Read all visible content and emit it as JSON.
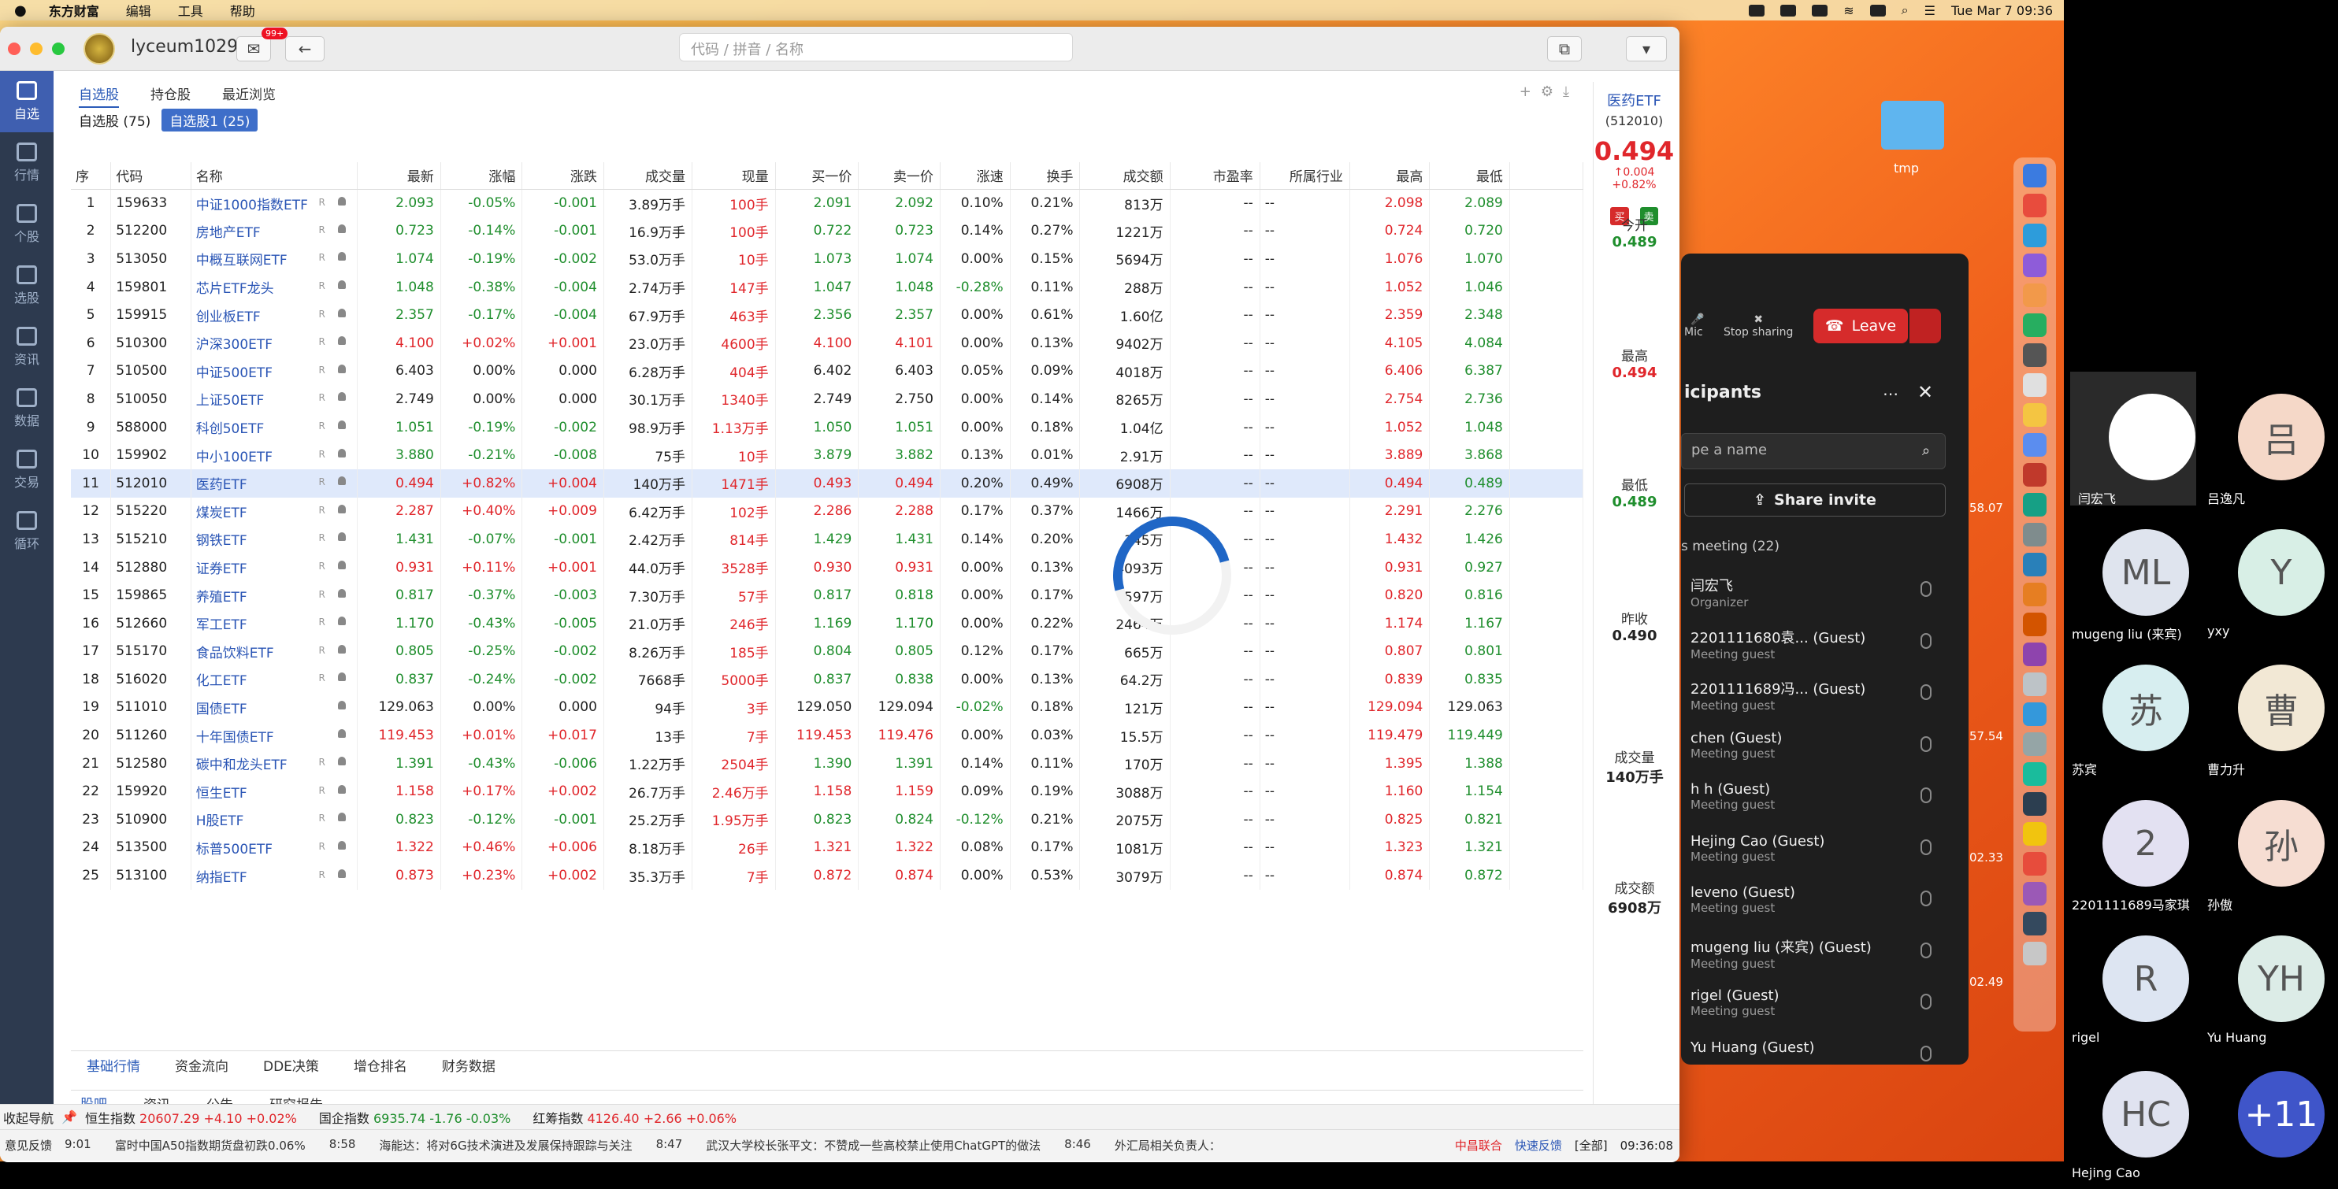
{
  "menubar": {
    "app": "东方财富",
    "menus": [
      "编辑",
      "工具",
      "帮助"
    ],
    "clock": "Tue Mar 7  09:36"
  },
  "toolbar": {
    "username": "lyceum1029",
    "badge": "99+",
    "search_placeholder": "代码 / 拼音 / 名称"
  },
  "sidebar": [
    {
      "label": "自选",
      "active": true
    },
    {
      "label": "行情"
    },
    {
      "label": "个股"
    },
    {
      "label": "选股"
    },
    {
      "label": "资讯"
    },
    {
      "label": "数据"
    },
    {
      "label": "交易"
    },
    {
      "label": "循环"
    }
  ],
  "tabs": [
    "自选股",
    "持仓股",
    "最近浏览"
  ],
  "subtabs": [
    "自选股 (75)",
    "自选股1 (25)"
  ],
  "columns": [
    "序",
    "代码",
    "名称",
    "最新",
    "涨幅",
    "涨跌",
    "成交量",
    "现量",
    "买一价",
    "卖一价",
    "涨速",
    "换手",
    "成交额",
    "市盈率",
    "所属行业",
    "最高",
    "最低"
  ],
  "rows": [
    [
      "1",
      "159633",
      "中证1000指数ETF",
      "R",
      "2.093",
      "-0.05%",
      "-0.001",
      "3.89万手",
      "100手",
      "2.091",
      "2.092",
      "0.10%",
      "0.21%",
      "813万",
      "--",
      "--",
      "2.098",
      "2.089"
    ],
    [
      "2",
      "512200",
      "房地产ETF",
      "R",
      "0.723",
      "-0.14%",
      "-0.001",
      "16.9万手",
      "100手",
      "0.722",
      "0.723",
      "0.14%",
      "0.27%",
      "1221万",
      "--",
      "--",
      "0.724",
      "0.720"
    ],
    [
      "3",
      "513050",
      "中概互联网ETF",
      "R",
      "1.074",
      "-0.19%",
      "-0.002",
      "53.0万手",
      "10手",
      "1.073",
      "1.074",
      "0.00%",
      "0.15%",
      "5694万",
      "--",
      "--",
      "1.076",
      "1.070"
    ],
    [
      "4",
      "159801",
      "芯片ETF龙头",
      "R",
      "1.048",
      "-0.38%",
      "-0.004",
      "2.74万手",
      "147手",
      "1.047",
      "1.048",
      "-0.28%",
      "0.11%",
      "288万",
      "--",
      "--",
      "1.052",
      "1.046"
    ],
    [
      "5",
      "159915",
      "创业板ETF",
      "R",
      "2.357",
      "-0.17%",
      "-0.004",
      "67.9万手",
      "463手",
      "2.356",
      "2.357",
      "0.00%",
      "0.61%",
      "1.60亿",
      "--",
      "--",
      "2.359",
      "2.348"
    ],
    [
      "6",
      "510300",
      "沪深300ETF",
      "R",
      "4.100",
      "+0.02%",
      "+0.001",
      "23.0万手",
      "4600手",
      "4.100",
      "4.101",
      "0.00%",
      "0.13%",
      "9402万",
      "--",
      "--",
      "4.105",
      "4.084"
    ],
    [
      "7",
      "510500",
      "中证500ETF",
      "R",
      "6.403",
      "0.00%",
      "0.000",
      "6.28万手",
      "404手",
      "6.402",
      "6.403",
      "0.05%",
      "0.09%",
      "4018万",
      "--",
      "--",
      "6.406",
      "6.387"
    ],
    [
      "8",
      "510050",
      "上证50ETF",
      "R",
      "2.749",
      "0.00%",
      "0.000",
      "30.1万手",
      "1340手",
      "2.749",
      "2.750",
      "0.00%",
      "0.14%",
      "8265万",
      "--",
      "--",
      "2.754",
      "2.736"
    ],
    [
      "9",
      "588000",
      "科创50ETF",
      "R",
      "1.051",
      "-0.19%",
      "-0.002",
      "98.9万手",
      "1.13万手",
      "1.050",
      "1.051",
      "0.00%",
      "0.18%",
      "1.04亿",
      "--",
      "--",
      "1.052",
      "1.048"
    ],
    [
      "10",
      "159902",
      "中小100ETF",
      "R",
      "3.880",
      "-0.21%",
      "-0.008",
      "75手",
      "10手",
      "3.879",
      "3.882",
      "0.13%",
      "0.01%",
      "2.91万",
      "--",
      "--",
      "3.889",
      "3.868"
    ],
    [
      "11",
      "512010",
      "医药ETF",
      "R",
      "0.494",
      "+0.82%",
      "+0.004",
      "140万手",
      "1471手",
      "0.493",
      "0.494",
      "0.20%",
      "0.49%",
      "6908万",
      "--",
      "--",
      "0.494",
      "0.489"
    ],
    [
      "12",
      "515220",
      "煤炭ETF",
      "R",
      "2.287",
      "+0.40%",
      "+0.009",
      "6.42万手",
      "102手",
      "2.286",
      "2.288",
      "0.17%",
      "0.37%",
      "1466万",
      "--",
      "--",
      "2.291",
      "2.276"
    ],
    [
      "13",
      "515210",
      "钢铁ETF",
      "R",
      "1.431",
      "-0.07%",
      "-0.001",
      "2.42万手",
      "814手",
      "1.429",
      "1.431",
      "0.14%",
      "0.20%",
      "345万",
      "--",
      "--",
      "1.432",
      "1.426"
    ],
    [
      "14",
      "512880",
      "证券ETF",
      "R",
      "0.931",
      "+0.11%",
      "+0.001",
      "44.0万手",
      "3528手",
      "0.930",
      "0.931",
      "0.00%",
      "0.13%",
      "4093万",
      "--",
      "--",
      "0.931",
      "0.927"
    ],
    [
      "15",
      "159865",
      "养殖ETF",
      "R",
      "0.817",
      "-0.37%",
      "-0.003",
      "7.30万手",
      "57手",
      "0.817",
      "0.818",
      "0.00%",
      "0.17%",
      "597万",
      "--",
      "--",
      "0.820",
      "0.816"
    ],
    [
      "16",
      "512660",
      "军工ETF",
      "R",
      "1.170",
      "-0.43%",
      "-0.005",
      "21.0万手",
      "246手",
      "1.169",
      "1.170",
      "0.00%",
      "0.22%",
      "2464万",
      "--",
      "--",
      "1.174",
      "1.167"
    ],
    [
      "17",
      "515170",
      "食品饮料ETF",
      "R",
      "0.805",
      "-0.25%",
      "-0.002",
      "8.26万手",
      "185手",
      "0.804",
      "0.805",
      "0.12%",
      "0.17%",
      "665万",
      "--",
      "--",
      "0.807",
      "0.801"
    ],
    [
      "18",
      "516020",
      "化工ETF",
      "R",
      "0.837",
      "-0.24%",
      "-0.002",
      "7668手",
      "5000手",
      "0.837",
      "0.838",
      "0.00%",
      "0.13%",
      "64.2万",
      "--",
      "--",
      "0.839",
      "0.835"
    ],
    [
      "19",
      "511010",
      "国债ETF",
      "",
      "129.063",
      "0.00%",
      "0.000",
      "94手",
      "3手",
      "129.050",
      "129.094",
      "-0.02%",
      "0.18%",
      "121万",
      "--",
      "--",
      "129.094",
      "129.063"
    ],
    [
      "20",
      "511260",
      "十年国债ETF",
      "",
      "119.453",
      "+0.01%",
      "+0.017",
      "13手",
      "7手",
      "119.453",
      "119.476",
      "0.00%",
      "0.03%",
      "15.5万",
      "--",
      "--",
      "119.479",
      "119.449"
    ],
    [
      "21",
      "512580",
      "碳中和龙头ETF",
      "R",
      "1.391",
      "-0.43%",
      "-0.006",
      "1.22万手",
      "2504手",
      "1.390",
      "1.391",
      "0.14%",
      "0.11%",
      "170万",
      "--",
      "--",
      "1.395",
      "1.388"
    ],
    [
      "22",
      "159920",
      "恒生ETF",
      "R",
      "1.158",
      "+0.17%",
      "+0.002",
      "26.7万手",
      "2.46万手",
      "1.158",
      "1.159",
      "0.09%",
      "0.19%",
      "3088万",
      "--",
      "--",
      "1.160",
      "1.154"
    ],
    [
      "23",
      "510900",
      "H股ETF",
      "R",
      "0.823",
      "-0.12%",
      "-0.001",
      "25.2万手",
      "1.95万手",
      "0.823",
      "0.824",
      "-0.12%",
      "0.21%",
      "2075万",
      "--",
      "--",
      "0.825",
      "0.821"
    ],
    [
      "24",
      "513500",
      "标普500ETF",
      "R",
      "1.322",
      "+0.46%",
      "+0.006",
      "8.18万手",
      "26手",
      "1.321",
      "1.322",
      "0.08%",
      "0.17%",
      "1081万",
      "--",
      "--",
      "1.323",
      "1.321"
    ],
    [
      "25",
      "513100",
      "纳指ETF",
      "R",
      "0.873",
      "+0.23%",
      "+0.002",
      "35.3万手",
      "7手",
      "0.872",
      "0.874",
      "0.00%",
      "0.53%",
      "3079万",
      "--",
      "--",
      "0.874",
      "0.872"
    ]
  ],
  "bottom_tabs": [
    "基础行情",
    "资金流向",
    "DDE决策",
    "增仓排名",
    "财务数据"
  ],
  "bottom_tabs2": [
    "股吧",
    "资讯",
    "公告",
    "研究报告"
  ],
  "quote": {
    "name": "医药ETF",
    "code": "(512010)",
    "price": "0.494",
    "change": "0.004",
    "pct": "+0.82%",
    "buy": "买",
    "sell": "卖",
    "stats": [
      {
        "label": "今开",
        "value": "0.489",
        "color": "#1f8e2d"
      },
      {
        "label": "最高",
        "value": "0.494",
        "color": "#e0262b"
      },
      {
        "label": "最低",
        "value": "0.489",
        "color": "#1f8e2d"
      },
      {
        "label": "昨收",
        "value": "0.490",
        "color": "#222"
      },
      {
        "label": "成交量",
        "value": "140万手",
        "color": "#222"
      },
      {
        "label": "成交额",
        "value": "6908万",
        "color": "#222"
      }
    ]
  },
  "status1": {
    "nav": "收起导航",
    "items": [
      {
        "name": "恒生指数",
        "v": "20607.29",
        "c": "+4.10",
        "p": "+0.02%"
      },
      {
        "name": "国企指数",
        "v": "6935.74",
        "c": "-1.76",
        "p": "-0.03%"
      },
      {
        "name": "红筹指数",
        "v": "4126.40",
        "c": "+2.66",
        "p": "+0.06%"
      }
    ]
  },
  "status2": {
    "feedback": "意见反馈",
    "news": [
      "9:01",
      "富时中国A50指数期货盘初跌0.06%",
      "8:58",
      "海能达：将对6G技术演进及发展保持跟踪与关注",
      "8:47",
      "武汉大学校长张平文：不赞成一些高校禁止使用ChatGPT的做法",
      "8:46",
      "外汇局相关负责人："
    ],
    "broker": "中昌联合",
    "quick": "快速反馈",
    "all": "[全部]",
    "time": "09:36:08"
  },
  "desktop": {
    "folder": "tmp"
  },
  "zoom": {
    "mic": "Mic",
    "stop": "Stop sharing",
    "leave": "Leave",
    "title": "icipants",
    "search": "pe a name",
    "invite": "Share invite",
    "in_meeting": "s meeting (22)",
    "participants": [
      {
        "name": "闫宏飞",
        "role": "Organizer"
      },
      {
        "name": "2201111680袁...    (Guest)",
        "role": "Meeting guest"
      },
      {
        "name": "2201111689冯...    (Guest)",
        "role": "Meeting guest"
      },
      {
        "name": "chen (Guest)",
        "role": "Meeting guest"
      },
      {
        "name": "h h (Guest)",
        "role": "Meeting guest"
      },
      {
        "name": "Hejing Cao (Guest)",
        "role": "Meeting guest"
      },
      {
        "name": "leveno (Guest)",
        "role": "Meeting guest"
      },
      {
        "name": "mugeng liu (来宾) (Guest)",
        "role": "Meeting guest"
      },
      {
        "name": "rigel (Guest)",
        "role": "Meeting guest"
      },
      {
        "name": "Yu Huang (Guest)",
        "role": ""
      }
    ],
    "edge_texts": [
      "58.07",
      "57.54",
      "02.33",
      "02.49"
    ]
  },
  "gallery": [
    {
      "initials": "",
      "name": "闫宏飞",
      "bg": "#ffffff"
    },
    {
      "initials": "吕",
      "name": "吕逸凡",
      "bg": "#f5d8c8"
    },
    {
      "initials": "ML",
      "name": "mugeng liu (来宾)",
      "bg": "#dfe4ee"
    },
    {
      "initials": "Y",
      "name": "yxy",
      "bg": "#d8efe6"
    },
    {
      "initials": "苏",
      "name": "苏宾",
      "bg": "#d7eef0"
    },
    {
      "initials": "曹",
      "name": "曹力升",
      "bg": "#f2e8d5"
    },
    {
      "initials": "2",
      "name": "2201111689马家琪",
      "bg": "#e3e1f2"
    },
    {
      "initials": "孙",
      "name": "孙傲",
      "bg": "#f6ddd2"
    },
    {
      "initials": "R",
      "name": "rigel",
      "bg": "#dde5f2"
    },
    {
      "initials": "YH",
      "name": "Yu Huang",
      "bg": "#dcece7"
    },
    {
      "initials": "HC",
      "name": "Hejing Cao",
      "bg": "#e0e3f0"
    },
    {
      "initials": "+11",
      "name": "",
      "bg": "#3f55c9"
    }
  ]
}
